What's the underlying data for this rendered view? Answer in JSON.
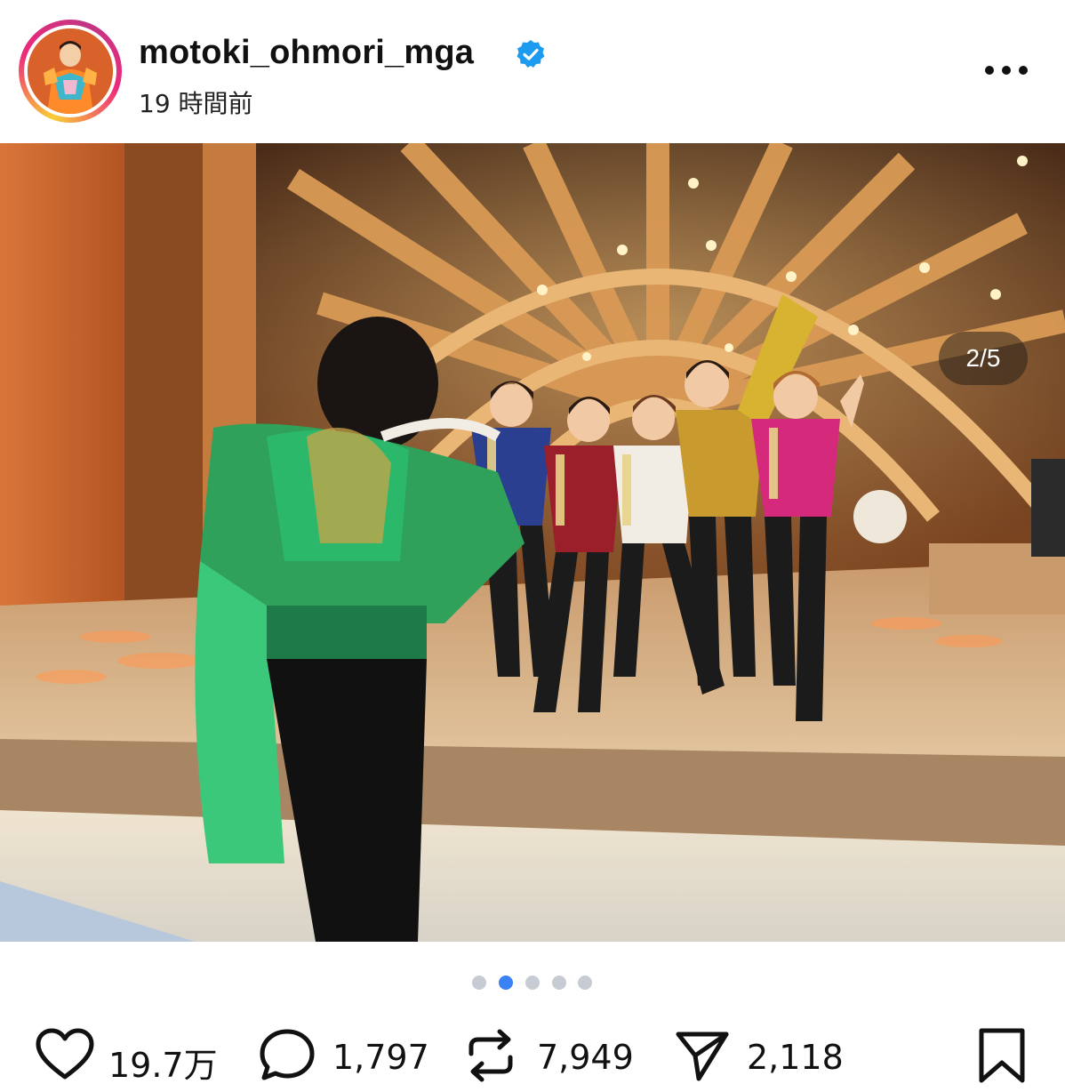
{
  "post": {
    "username": "motoki_ohmori_mga",
    "timestamp": "19 時間前",
    "verified": true,
    "more_icon": "more-horizontal-icon"
  },
  "media": {
    "counter": "2/5",
    "current_index": 2,
    "total": 5
  },
  "actions": {
    "likes": "19.7万",
    "comments": "1,797",
    "reposts": "7,949",
    "shares": "2,118"
  },
  "colors": {
    "accent": "#3b82f6",
    "verified": "#1d9bf0",
    "dot_inactive": "#c7ccd4"
  }
}
